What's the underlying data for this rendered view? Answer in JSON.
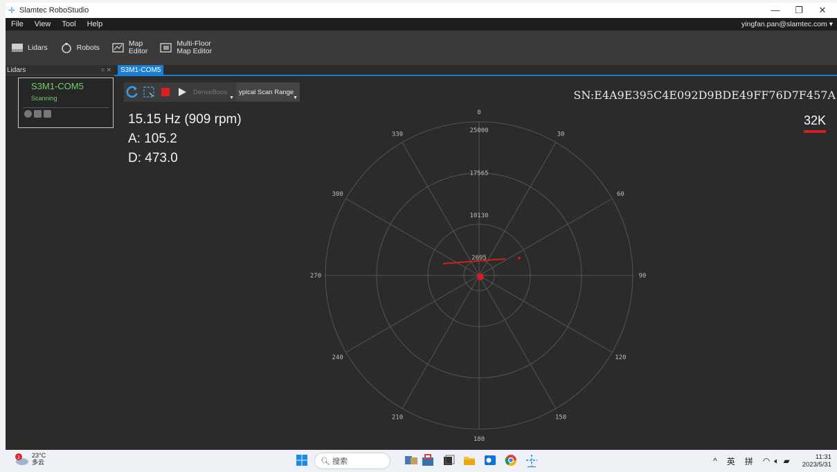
{
  "window": {
    "title": "Slamtec RoboStudio"
  },
  "menu": {
    "items": [
      "File",
      "View",
      "Tool",
      "Help"
    ],
    "user": "yingfan.pan@slamtec.com"
  },
  "toolbar": {
    "lidars_label": "Lidars",
    "robots_label": "Robots",
    "map_editor_line1": "Map",
    "map_editor_line2": "Editor",
    "multifloor_line1": "Multi-Floor",
    "multifloor_line2": "Map Editor"
  },
  "panes": {
    "lidars_title": "Lidars",
    "doc_tab": "S3M1-COM5"
  },
  "device": {
    "name": "S3M1-COM5",
    "status": "Scanning"
  },
  "controls": {
    "boost_label": "DenseBoos",
    "scan_range_label": "ypical Scan Range"
  },
  "readouts": {
    "frequency": "15.15 Hz (909 rpm)",
    "angle": "A: 105.2",
    "distance": "D: 473.0"
  },
  "serial": "SN:E4A9E395C4E092D9BDE49FF76D7F457A",
  "mode": {
    "label": "32K",
    "color": "#d12020"
  },
  "polar": {
    "radial_ticks": [
      "25000",
      "17565",
      "10130",
      "2695"
    ],
    "angle_labels": [
      "0",
      "30",
      "60",
      "90",
      "120",
      "150",
      "180",
      "210",
      "240",
      "270",
      "300",
      "330"
    ],
    "scan_color": "#d12020",
    "grid_color": "#555555"
  },
  "taskbar": {
    "weather_temp": "23°C",
    "weather_desc": "多云",
    "weather_badge": "1",
    "search_text": "搜索",
    "tray_caret": "^",
    "ime1": "英",
    "ime2": "拼",
    "time": "11:31",
    "date": "2023/5/31"
  }
}
